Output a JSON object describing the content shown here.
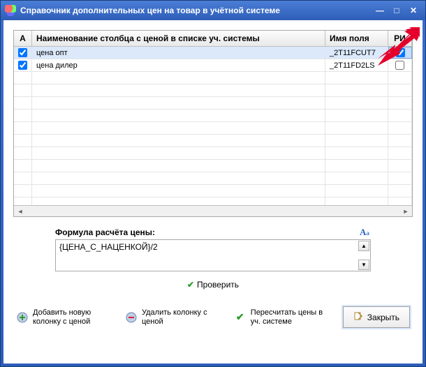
{
  "window": {
    "title": "Справочник дополнительных цен на товар в учётной системе"
  },
  "grid": {
    "headers": {
      "a": "А",
      "name": "Наименование столбца с ценой в списке уч. системы",
      "field": "Имя поля",
      "ri": "РИ"
    },
    "rows": [
      {
        "active": true,
        "name": "цена опт",
        "field": "_2T11FCUT7",
        "ri": true,
        "selected": true
      },
      {
        "active": true,
        "name": "цена дилер",
        "field": "_2T11FD2LS",
        "ri": false,
        "selected": false
      }
    ]
  },
  "formula": {
    "label": "Формула расчёта цены:",
    "value": "{ЦЕНА_С_НАЦЕНКОЙ}/2"
  },
  "verify": {
    "label": "Проверить"
  },
  "actions": {
    "add": "Добавить новую колонку с ценой",
    "delete": "Удалить колонку с ценой",
    "recalc": "Пересчитать цены в уч. системе",
    "close": "Закрыть"
  }
}
